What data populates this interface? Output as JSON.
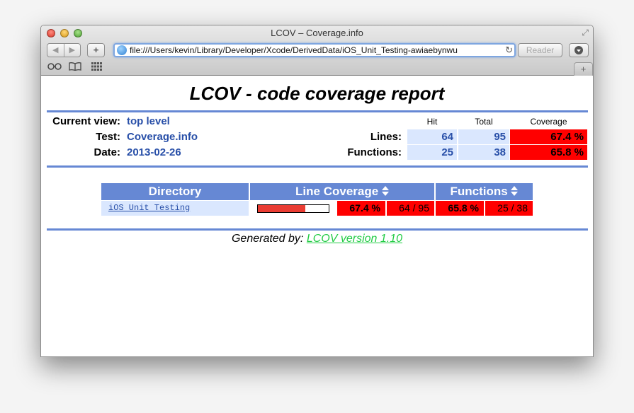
{
  "window": {
    "title": "LCOV – Coverage.info",
    "url": "file:///Users/kevin/Library/Developer/Xcode/DerivedData/iOS_Unit_Testing-awiaebynwu",
    "reader_label": "Reader",
    "add_label": "+",
    "back_icon": "◀",
    "forward_icon": "▶"
  },
  "report": {
    "title": "LCOV - code coverage report",
    "current_view_label": "Current view:",
    "current_view_value": "top level",
    "test_label": "Test:",
    "test_value": "Coverage.info",
    "date_label": "Date:",
    "date_value": "2013-02-26",
    "col_hit": "Hit",
    "col_total": "Total",
    "col_coverage": "Coverage",
    "lines_label": "Lines:",
    "lines_hit": "64",
    "lines_total": "95",
    "lines_coverage": "67.4 %",
    "functions_label": "Functions:",
    "functions_hit": "25",
    "functions_total": "38",
    "functions_coverage": "65.8 %"
  },
  "table": {
    "headers": {
      "directory": "Directory",
      "line_coverage": "Line Coverage",
      "functions": "Functions"
    },
    "rows": [
      {
        "directory": "iOS Unit Testing",
        "line_fraction": 0.674,
        "line_pct": "67.4 %",
        "line_ratio": "64 / 95",
        "func_pct": "65.8 %",
        "func_ratio": "25 / 38"
      }
    ]
  },
  "footer": {
    "prefix": "Generated by:",
    "link_text": "LCOV version 1.10"
  },
  "colors": {
    "header_blue": "#6688d4",
    "value_blue": "#284fa8",
    "low_coverage_red": "#ff0000",
    "link_green": "#22cc44"
  },
  "icons": {
    "sort": "sort-arrows-icon",
    "reload": "reload-icon",
    "globe": "globe-icon",
    "download": "download-icon",
    "reading_list": "reading-list-icon",
    "bookmarks": "bookmarks-icon",
    "top_sites": "top-sites-icon"
  }
}
